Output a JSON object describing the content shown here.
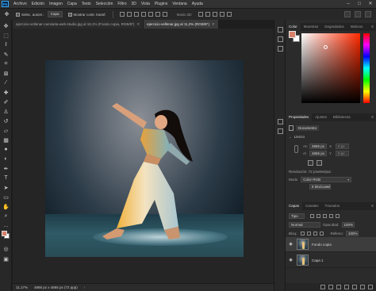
{
  "menubar": {
    "logo": "Ps",
    "items": [
      "Archivo",
      "Edición",
      "Imagen",
      "Capa",
      "Texto",
      "Selección",
      "Filtro",
      "3D",
      "Vista",
      "Plugins",
      "Ventana",
      "Ayuda"
    ],
    "window_controls": [
      "–",
      "□",
      "✕"
    ]
  },
  "options": {
    "auto_select_label": "Selec. autom.:",
    "auto_select_value": "Capa",
    "show_transform_label": "Mostrar contr. transf.",
    "mode_3d": "Modo 3D:"
  },
  "tabs": [
    {
      "label": "ejercicio-vellenar-camiseta-web-studio.jpg al 18,1% (Fondo copia, RGB/8*)",
      "active": false
    },
    {
      "label": "ejercicio-vellenar.jpg al 11,2% (RGB/8*)",
      "active": true
    }
  ],
  "status": {
    "zoom": "11,17%",
    "dimensions": "4865 px x 4865 px (72 ppp)"
  },
  "color_panel": {
    "tabs": [
      "Color",
      "Muestras",
      "Degradados",
      "Motivos"
    ],
    "foreground": "#d9806b",
    "background": "#ffffff"
  },
  "properties": {
    "tabs": [
      "Propiedades",
      "Ajustes",
      "Bibliotecas"
    ],
    "doc_label": "Documento",
    "section": "Lienzo",
    "w_label": "An",
    "w_value": "4865 px",
    "h_label": "Al",
    "h_value": "4865 px",
    "x_label": "X",
    "x_value": "0 px",
    "y_label": "Y",
    "y_value": "0 px",
    "resolution": "Resolución: 72 píxeles/pul.",
    "mode_label": "Modo",
    "mode_value": "Color RGB",
    "bits_value": "8 bits/canal"
  },
  "layers": {
    "tabs": [
      "Capas",
      "Canales",
      "Trazados"
    ],
    "kind": "Tipo",
    "blend": "Normal",
    "opacity_label": "Opacidad:",
    "opacity_value": "100%",
    "lock_label": "Bloq.:",
    "fill_label": "Relleno:",
    "fill_value": "100%",
    "items": [
      {
        "name": "Fondo copia",
        "visible": true,
        "active": true
      },
      {
        "name": "Capa 1",
        "visible": true,
        "active": false
      }
    ]
  },
  "tool_icons": [
    "move-icon",
    "marquee-icon",
    "lasso-icon",
    "quick-select-icon",
    "crop-icon",
    "frame-icon",
    "eyedropper-icon",
    "healing-icon",
    "brush-icon",
    "clone-stamp-icon",
    "history-brush-icon",
    "eraser-icon",
    "gradient-icon",
    "blur-icon",
    "dodge-icon",
    "pen-icon",
    "type-icon",
    "path-select-icon",
    "rectangle-icon",
    "hand-icon",
    "zoom-icon",
    "more-tools-icon"
  ]
}
